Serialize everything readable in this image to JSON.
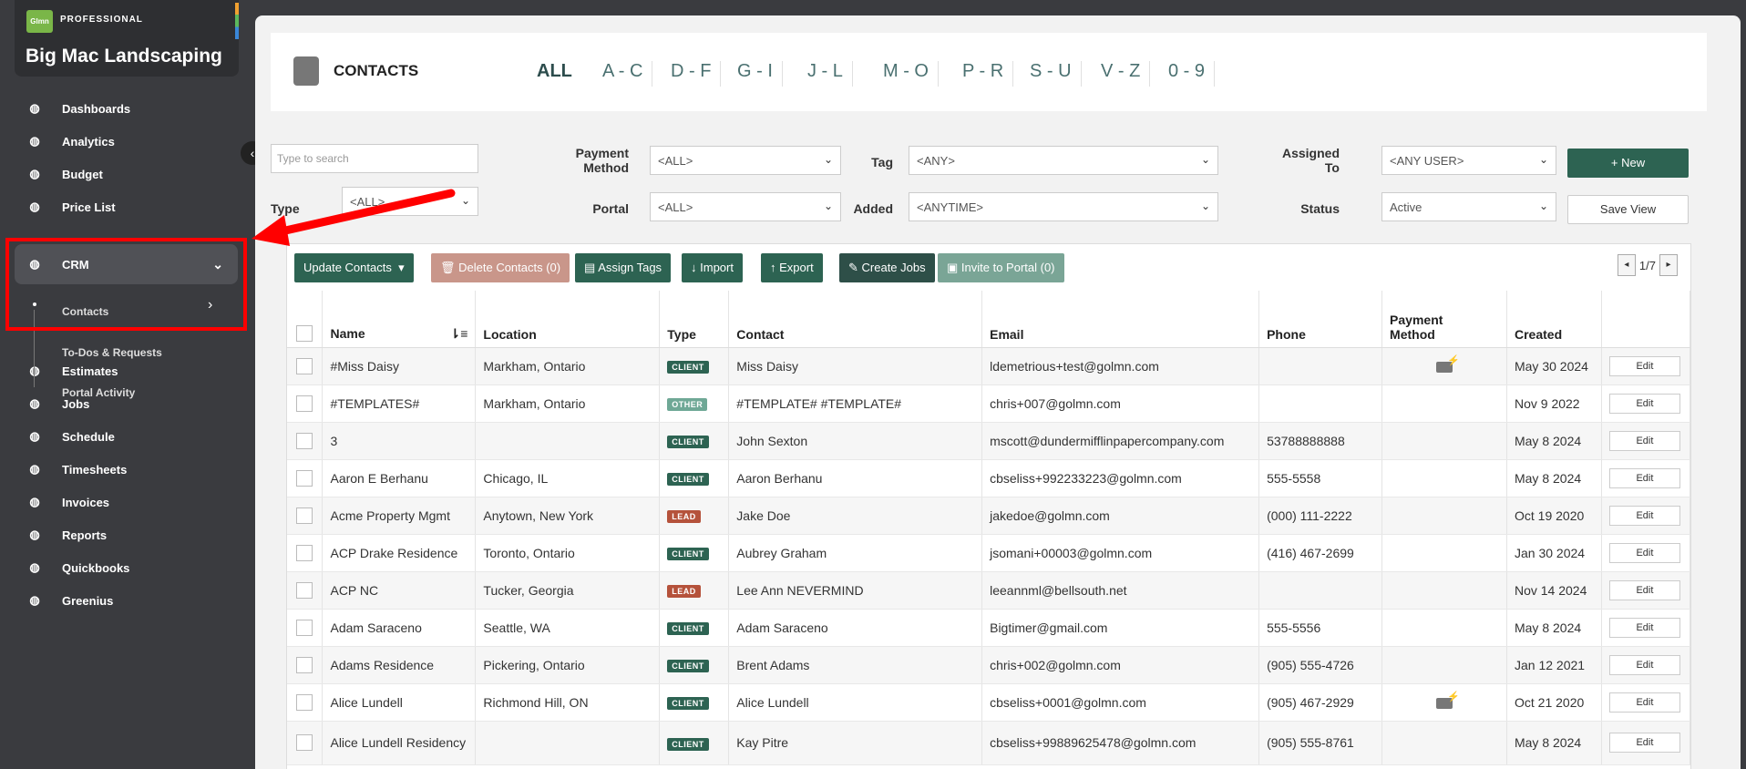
{
  "brand": {
    "logo": "Glmn",
    "tier": "PROFESSIONAL",
    "name": "Big Mac Landscaping"
  },
  "nav": [
    {
      "label": "Dashboards",
      "icon": "gauge-icon"
    },
    {
      "label": "Analytics",
      "icon": "chart-line-icon"
    },
    {
      "label": "Budget",
      "icon": "pie-chart-icon"
    },
    {
      "label": "Price List",
      "icon": "list-icon"
    },
    {
      "label": "CRM",
      "icon": "address-book-icon"
    },
    {
      "label": "Estimates",
      "icon": "calculator-icon"
    },
    {
      "label": "Jobs",
      "icon": "warehouse-icon"
    },
    {
      "label": "Schedule",
      "icon": "calendar-icon"
    },
    {
      "label": "Timesheets",
      "icon": "clock-icon"
    },
    {
      "label": "Invoices",
      "icon": "invoice-icon"
    },
    {
      "label": "Reports",
      "icon": "report-icon"
    },
    {
      "label": "Quickbooks",
      "icon": "quickbooks-icon"
    },
    {
      "label": "Greenius",
      "icon": "play-circle-icon"
    }
  ],
  "crm_sub": [
    "Contacts",
    "To-Dos & Requests",
    "Portal Activity"
  ],
  "header": {
    "title": "CONTACTS",
    "alpha": [
      "ALL",
      "A - C",
      "D - F",
      "G - I",
      "J - L",
      "M - O",
      "P - R",
      "S - U",
      "V - Z",
      "0 - 9"
    ]
  },
  "filters": {
    "search_placeholder": "Type to search",
    "type_label": "Type",
    "type_value": "<ALL>",
    "payment_label_1": "Payment",
    "payment_label_2": "Method",
    "payment_value": "<ALL>",
    "portal_label": "Portal",
    "portal_value": "<ALL>",
    "tag_label": "Tag",
    "tag_value": "<ANY>",
    "added_label": "Added",
    "added_value": "<ANYTIME>",
    "assigned_label_1": "Assigned",
    "assigned_label_2": "To",
    "assigned_value": "<ANY USER>",
    "status_label": "Status",
    "status_value": "Active",
    "new_label": "+ New",
    "save_view_label": "Save View"
  },
  "toolbar": {
    "update": "Update Contacts",
    "delete": "Delete Contacts (0)",
    "assign_tags": "Assign Tags",
    "import": "Import",
    "export": "Export",
    "create_jobs": "Create Jobs",
    "invite": "Invite to Portal (0)",
    "page": "1/7"
  },
  "table": {
    "headers": [
      "Name",
      "Location",
      "Type",
      "Contact",
      "Email",
      "Phone",
      "Payment Method",
      "Created"
    ],
    "edit_label": "Edit",
    "rows": [
      {
        "name": "#Miss Daisy",
        "location": "Markham, Ontario",
        "type": "CLIENT",
        "contact": "Miss Daisy",
        "email": "ldemetrious+test@golmn.com",
        "phone": "",
        "pay": true,
        "created": "May 30 2024"
      },
      {
        "name": "#TEMPLATES#",
        "location": "Markham, Ontario",
        "type": "OTHER",
        "contact": "#TEMPLATE# #TEMPLATE#",
        "email": "chris+007@golmn.com",
        "phone": "",
        "pay": false,
        "created": "Nov 9 2022"
      },
      {
        "name": "3",
        "location": "",
        "type": "CLIENT",
        "contact": "John Sexton",
        "email": "mscott@dundermifflinpapercompany.com",
        "phone": "53788888888",
        "pay": false,
        "created": "May 8 2024"
      },
      {
        "name": "Aaron E Berhanu",
        "location": "Chicago, IL",
        "type": "CLIENT",
        "contact": "Aaron Berhanu",
        "email": "cbseliss+992233223@golmn.com",
        "phone": "555-5558",
        "pay": false,
        "created": "May 8 2024"
      },
      {
        "name": "Acme Property Mgmt",
        "location": "Anytown, New York",
        "type": "LEAD",
        "contact": "Jake Doe",
        "email": "jakedoe@golmn.com",
        "phone": "(000) 111-2222",
        "pay": false,
        "created": "Oct 19 2020"
      },
      {
        "name": "ACP Drake Residence",
        "location": "Toronto, Ontario",
        "type": "CLIENT",
        "contact": "Aubrey Graham",
        "email": "jsomani+00003@golmn.com",
        "phone": "(416) 467-2699",
        "pay": false,
        "created": "Jan 30 2024"
      },
      {
        "name": "ACP NC",
        "location": "Tucker, Georgia",
        "type": "LEAD",
        "contact": "Lee Ann NEVERMIND",
        "email": "leeannml@bellsouth.net",
        "phone": "",
        "pay": false,
        "created": "Nov 14 2024"
      },
      {
        "name": "Adam Saraceno",
        "location": "Seattle, WA",
        "type": "CLIENT",
        "contact": "Adam Saraceno",
        "email": "Bigtimer@gmail.com",
        "phone": "555-5556",
        "pay": false,
        "created": "May 8 2024"
      },
      {
        "name": "Adams Residence",
        "location": "Pickering, Ontario",
        "type": "CLIENT",
        "contact": "Brent Adams",
        "email": "chris+002@golmn.com",
        "phone": "(905) 555-4726",
        "pay": false,
        "created": "Jan 12 2021"
      },
      {
        "name": "Alice Lundell",
        "location": "Richmond Hill, ON",
        "type": "CLIENT",
        "contact": "Alice Lundell",
        "email": "cbseliss+0001@golmn.com",
        "phone": "(905) 467-2929",
        "pay": true,
        "created": "Oct 21 2020"
      },
      {
        "name": "Alice Lundell Residency",
        "location": "",
        "type": "CLIENT",
        "contact": "Kay Pitre",
        "email": "cbseliss+99889625478@golmn.com",
        "phone": "(905) 555-8761",
        "pay": false,
        "created": "May 8 2024"
      }
    ]
  },
  "colors": {
    "client": "#2d6352",
    "other": "#6fa896",
    "lead": "#b5523b",
    "accent": "#2d6352",
    "highlight": "#ff0000"
  }
}
